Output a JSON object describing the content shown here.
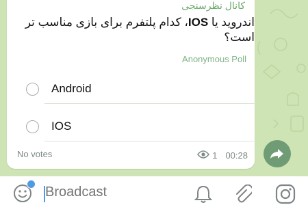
{
  "message": {
    "channel_name": "کانال نظرسنجی",
    "question_before": "اندروید یا ",
    "question_bold": "IOS",
    "question_after": "، کدام پلتفرم برای بازی مناسب تر است؟",
    "poll_type": "Anonymous Poll",
    "options": [
      {
        "label": "Android"
      },
      {
        "label": "IOS"
      }
    ],
    "votes_text": "No votes",
    "views": "1",
    "time": "00:28"
  },
  "composer": {
    "placeholder": "Broadcast"
  },
  "icons": {
    "share": "share-arrow-icon",
    "emoji": "emoji-icon",
    "bell": "bell-icon",
    "attach": "paperclip-icon",
    "camera": "instagram-camera-icon",
    "views": "eye-icon"
  },
  "colors": {
    "chat_background": "#cfe4b4",
    "accent_green": "#6aa96b",
    "share_button": "#6f9c75",
    "cursor_blue": "#4f9ae0"
  }
}
